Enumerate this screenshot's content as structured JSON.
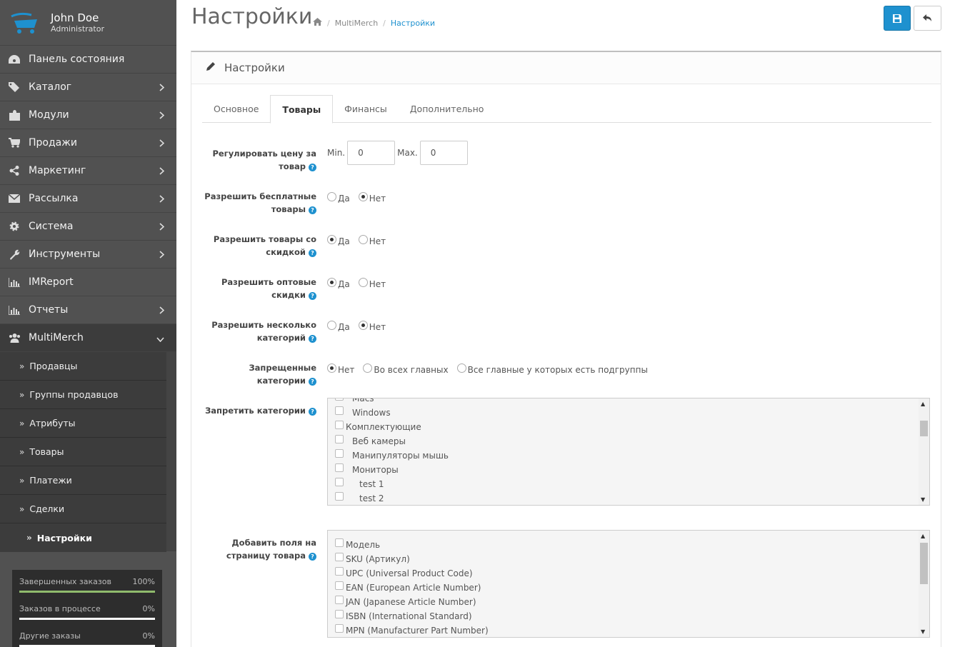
{
  "user": {
    "name": "John Doe",
    "role": "Administrator"
  },
  "menu": [
    {
      "label": "Панель состояния",
      "icon": "dashboard-icon",
      "has_children": false
    },
    {
      "label": "Каталог",
      "icon": "tags-icon",
      "has_children": true
    },
    {
      "label": "Модули",
      "icon": "puzzle-icon",
      "has_children": true
    },
    {
      "label": "Продажи",
      "icon": "cart-icon",
      "has_children": true
    },
    {
      "label": "Маркетинг",
      "icon": "share-icon",
      "has_children": true
    },
    {
      "label": "Рассылка",
      "icon": "envelope-icon",
      "has_children": true
    },
    {
      "label": "Система",
      "icon": "gear-icon",
      "has_children": true
    },
    {
      "label": "Инструменты",
      "icon": "wrench-icon",
      "has_children": true
    },
    {
      "label": "IMReport",
      "icon": "bar-chart-icon",
      "has_children": false
    },
    {
      "label": "Отчеты",
      "icon": "bar-chart-icon",
      "has_children": true
    },
    {
      "label": "MultiMerch",
      "icon": "users-icon",
      "has_children": true,
      "expanded": true
    }
  ],
  "submenu": [
    "Продавцы",
    "Группы продавцов",
    "Атрибуты",
    "Товары",
    "Платежи",
    "Сделки",
    "Настройки"
  ],
  "stats": [
    {
      "label": "Завершенных заказов",
      "value": "100%",
      "fraction": 1.0
    },
    {
      "label": "Заказов в процессе",
      "value": "0%",
      "fraction": 0.0
    },
    {
      "label": "Другие заказы",
      "value": "0%",
      "fraction": 0.0
    }
  ],
  "header": {
    "title": "Настройки",
    "breadcrumb": [
      "MultiMerch",
      "Настройки"
    ]
  },
  "panel": {
    "title": "Настройки",
    "tabs": [
      "Основное",
      "Товары",
      "Финансы",
      "Дополнительно"
    ],
    "active_tab": "Товары"
  },
  "form": {
    "price": {
      "label": "Регулировать цену за товар",
      "min_label": "Min.",
      "min_value": "0",
      "max_label": "Max.",
      "max_value": "0"
    },
    "free": {
      "label": "Разрешить бесплатные товары",
      "options": [
        "Да",
        "Нет"
      ],
      "selected": "Нет"
    },
    "discount": {
      "label": "Разрешить товары со скидкой",
      "options": [
        "Да",
        "Нет"
      ],
      "selected": "Да"
    },
    "wholesale": {
      "label": "Разрешить оптовые скидки",
      "options": [
        "Да",
        "Нет"
      ],
      "selected": "Да"
    },
    "multicat": {
      "label": "Разрешить несколько категорий",
      "options": [
        "Да",
        "Нет"
      ],
      "selected": "Нет"
    },
    "forbidden": {
      "label": "Запрещенные категории",
      "options": [
        "Нет",
        "Во всех главных",
        "Все главные у которых есть подгруппы"
      ],
      "selected": "Нет"
    },
    "forbid_cats": {
      "label": "Запретить категории",
      "items": [
        {
          "label": "Macs",
          "level": 1
        },
        {
          "label": "Windows",
          "level": 1
        },
        {
          "label": "Комплектующие",
          "level": 0
        },
        {
          "label": "Веб камеры",
          "level": 1
        },
        {
          "label": "Манипуляторы мышь",
          "level": 1
        },
        {
          "label": "Мониторы",
          "level": 1
        },
        {
          "label": "test 1",
          "level": 2
        },
        {
          "label": "test 2",
          "level": 2
        }
      ]
    },
    "fields": {
      "label": "Добавить поля на страницу товара",
      "items": [
        "Модель",
        "SKU (Артикул)",
        "UPC (Universal Product Code)",
        "EAN (European Article Number)",
        "JAN (Japanese Article Number)",
        "ISBN (International Standard)",
        "MPN (Manufacturer Part Number)"
      ]
    }
  }
}
